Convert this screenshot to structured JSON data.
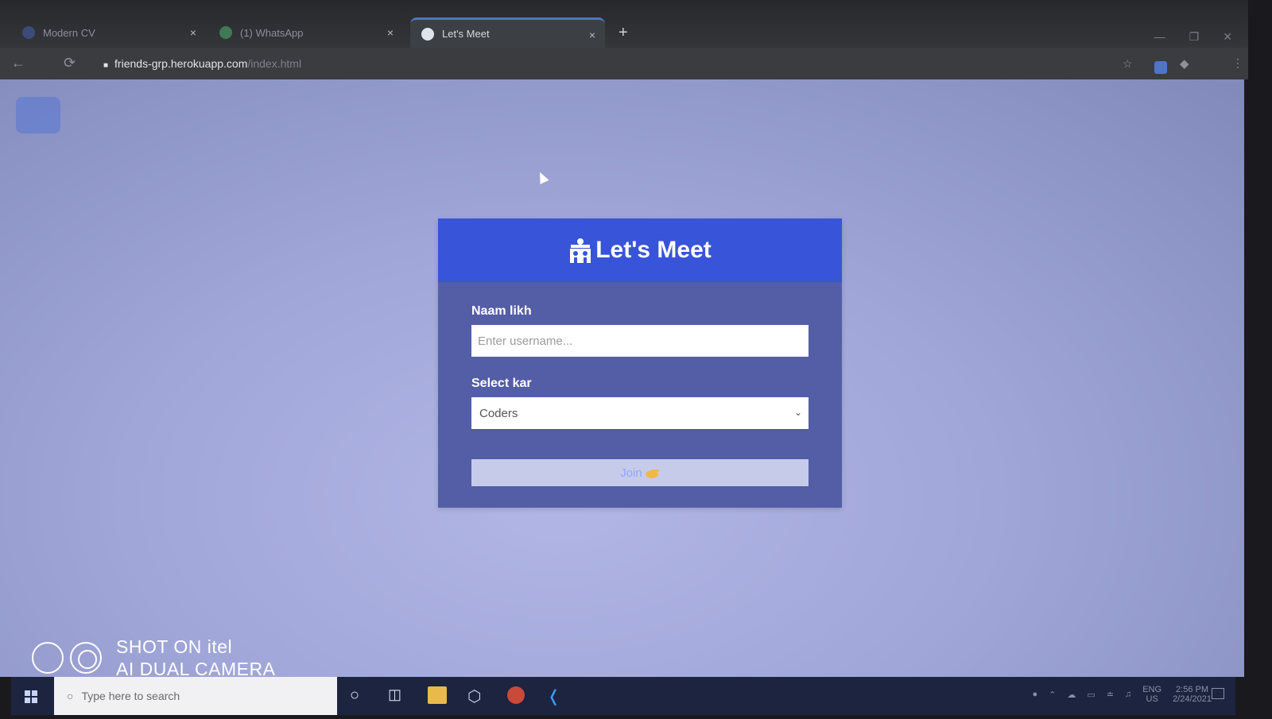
{
  "browser": {
    "tabs": [
      {
        "title": "Modern CV",
        "close": "×",
        "active": false
      },
      {
        "title": "(1) WhatsApp",
        "close": "×",
        "active": false
      },
      {
        "title": "Let's Meet",
        "close": "×",
        "active": true
      }
    ],
    "new_tab": "+",
    "url_host": "friends-grp.herokuapp.com",
    "url_path": "/index.html"
  },
  "app": {
    "title": "Let's Meet",
    "username_label": "Naam likh",
    "username_placeholder": "Enter username...",
    "room_label": "Select kar",
    "room_selected": "Coders",
    "join_label": "Join"
  },
  "watermark": {
    "line1": "SHOT ON itel",
    "line2": "AI DUAL CAMERA"
  },
  "taskbar": {
    "search_placeholder": "Type here to search",
    "lang_top": "ENG",
    "lang_bottom": "US",
    "time": "2:56 PM",
    "date": "2/24/2021"
  },
  "colors": {
    "header": "#3854d8",
    "card": "#545ea6",
    "page": "#a0a6d8"
  }
}
